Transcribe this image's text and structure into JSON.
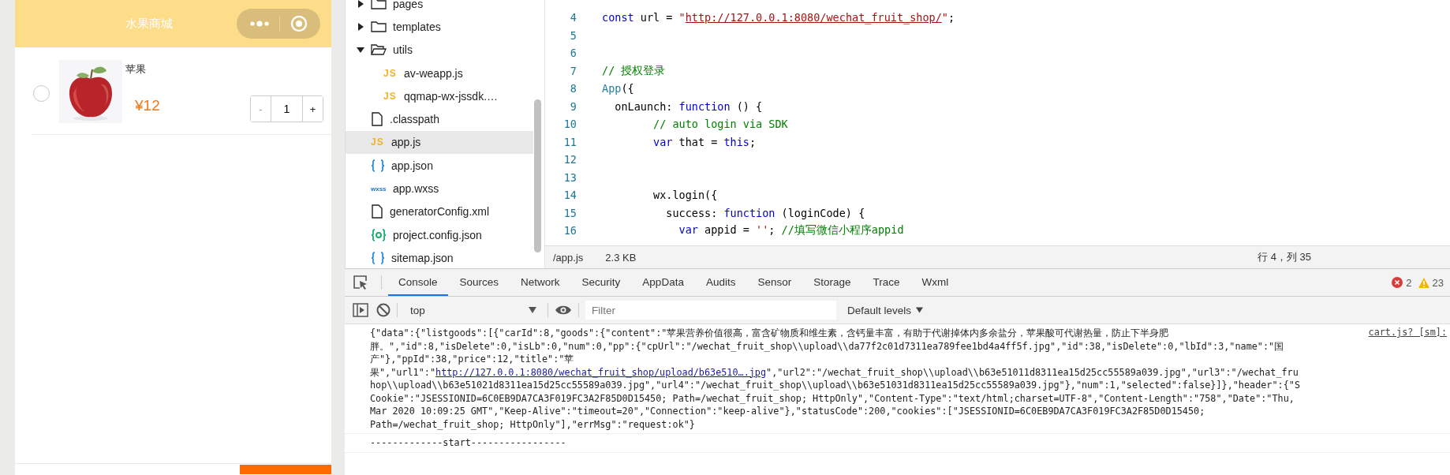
{
  "phone": {
    "title": "水果商城",
    "cart_items": [
      {
        "name": "苹果",
        "price": "¥12",
        "quantity": "1",
        "checked": false,
        "minus": "-",
        "plus": "+"
      }
    ]
  },
  "tree": {
    "items": [
      {
        "name": "pages",
        "kind": "folder",
        "expanded": false,
        "selected": false
      },
      {
        "name": "templates",
        "kind": "folder",
        "expanded": false,
        "selected": false
      },
      {
        "name": "utils",
        "kind": "folder",
        "expanded": true,
        "selected": false,
        "children": [
          {
            "name": "av-weapp.js",
            "kind": "js",
            "icon_text": "JS",
            "selected": false
          },
          {
            "name": "qqmap-wx-jssdk.…",
            "kind": "js",
            "icon_text": "JS",
            "selected": false
          }
        ]
      },
      {
        "name": ".classpath",
        "kind": "file",
        "selected": false
      },
      {
        "name": "app.js",
        "kind": "js",
        "icon_text": "JS",
        "selected": true
      },
      {
        "name": "app.json",
        "kind": "json",
        "selected": false
      },
      {
        "name": "app.wxss",
        "kind": "wxss",
        "icon_text": "wxss",
        "selected": false
      },
      {
        "name": "generatorConfig.xml",
        "kind": "file",
        "selected": false
      },
      {
        "name": "project.config.json",
        "kind": "config",
        "selected": false
      },
      {
        "name": "sitemap.json",
        "kind": "json",
        "selected": false
      }
    ]
  },
  "editor": {
    "lines": [
      {
        "number": "4",
        "parts": [
          {
            "kind": "keyword",
            "text": "const"
          },
          {
            "kind": "plain",
            "text": " url = "
          },
          {
            "kind": "string",
            "text": "\""
          },
          {
            "kind": "link",
            "text": "http://127.0.0.1:8080/wechat_fruit_shop/"
          },
          {
            "kind": "string",
            "text": "\""
          },
          {
            "kind": "plain",
            "text": ";"
          }
        ]
      },
      {
        "number": "5"
      },
      {
        "number": "6"
      },
      {
        "number": "7",
        "parts": [
          {
            "kind": "comment",
            "text": "// 授权登录"
          }
        ]
      },
      {
        "number": "8",
        "parts": [
          {
            "kind": "type",
            "text": "App"
          },
          {
            "kind": "plain",
            "text": "({"
          }
        ]
      },
      {
        "number": "9",
        "parts": [
          {
            "kind": "plain",
            "text": "  onLaunch: "
          },
          {
            "kind": "keyword",
            "text": "function"
          },
          {
            "kind": "plain",
            "text": " () {"
          }
        ]
      },
      {
        "number": "10",
        "parts": [
          {
            "kind": "comment",
            "text": "        // auto login via SDK"
          }
        ]
      },
      {
        "number": "11",
        "parts": [
          {
            "kind": "keyword",
            "text": "        var"
          },
          {
            "kind": "plain",
            "text": " that = "
          },
          {
            "kind": "keyword",
            "text": "this"
          },
          {
            "kind": "plain",
            "text": ";"
          }
        ]
      },
      {
        "number": "12"
      },
      {
        "number": "13"
      },
      {
        "number": "14",
        "parts": [
          {
            "kind": "plain",
            "text": "        wx.login({"
          }
        ]
      },
      {
        "number": "15",
        "parts": [
          {
            "kind": "plain",
            "text": "          success: "
          },
          {
            "kind": "keyword",
            "text": "function"
          },
          {
            "kind": "plain",
            "text": " (loginCode) {"
          }
        ]
      },
      {
        "number": "16",
        "parts": [
          {
            "kind": "keyword",
            "text": "            var"
          },
          {
            "kind": "plain",
            "text": " appid = "
          },
          {
            "kind": "string",
            "text": "''"
          },
          {
            "kind": "plain",
            "text": "; "
          },
          {
            "kind": "comment",
            "text": "//填写微信小程序appid"
          }
        ]
      }
    ],
    "status": {
      "path": "/app.js",
      "size": "2.3 KB",
      "cursor": "行 4，列 35"
    }
  },
  "devtools": {
    "tabs": [
      {
        "label": "Console",
        "selected": true
      },
      {
        "label": "Sources",
        "selected": false
      },
      {
        "label": "Network",
        "selected": false
      },
      {
        "label": "Security",
        "selected": false
      },
      {
        "label": "AppData",
        "selected": false
      },
      {
        "label": "Audits",
        "selected": false
      },
      {
        "label": "Sensor",
        "selected": false
      },
      {
        "label": "Storage",
        "selected": false
      },
      {
        "label": "Trace",
        "selected": false
      },
      {
        "label": "Wxml",
        "selected": false
      }
    ],
    "errors": "2",
    "warnings": "23",
    "context": "top",
    "filter_placeholder": "Filter",
    "levels": "Default levels"
  },
  "console": {
    "messages": [
      {
        "source": "cart.js? [sm]:",
        "lines": [
          [
            {
              "kind": "text",
              "text": "{\"data\":{\"listgoods\":[{\"carId\":8,\"goods\":{\"content\":\"苹果营养价值很高，富含矿物质和维生素，含钙量丰富，有助于代谢掉体内多余盐分，苹果酸可代谢热量，防止下半身肥"
            }
          ],
          [
            {
              "kind": "text",
              "text": "胖。\",\"id\":8,\"isDelete\":0,\"isLb\":0,\"num\":0,\"pp\":{\"cpUrl\":\"/wechat_fruit_shop\\\\upload\\\\da77f2c01d7311ea789fee1bd4a4ff5f.jpg\",\"id\":38,\"isDelete\":0,\"lbId\":3,\"name\":\"国"
            }
          ],
          [
            {
              "kind": "text",
              "text": "产\"},\"ppId\":38,\"price\":12,\"title\":\"苹"
            }
          ],
          [
            {
              "kind": "text",
              "text": "果\",\"url1\":\""
            },
            {
              "kind": "link",
              "text": "http://127.0.0.1:8080/wechat_fruit_shop/upload/b63e510….jpg"
            },
            {
              "kind": "text",
              "text": "\",\"url2\":\"/wechat_fruit_shop\\\\upload\\\\b63e51011d8311ea15d25cc55589a039.jpg\",\"url3\":\"/wechat_fru"
            }
          ],
          [
            {
              "kind": "text",
              "text": "hop\\\\upload\\\\b63e51021d8311ea15d25cc55589a039.jpg\",\"url4\":\"/wechat_fruit_shop\\\\upload\\\\b63e51031d8311ea15d25cc55589a039.jpg\"},\"num\":1,\"selected\":false}]},\"header\":{\"S"
            }
          ],
          [
            {
              "kind": "text",
              "text": "Cookie\":\"JSESSIONID=6C0EB9DA7CA3F019FC3A2F85D0D15450; Path=/wechat_fruit_shop; HttpOnly\",\"Content-Type\":\"text/html;charset=UTF-8\",\"Content-Length\":\"758\",\"Date\":\"Thu,"
            }
          ],
          [
            {
              "kind": "text",
              "text": "Mar 2020 10:09:25 GMT\",\"Keep-Alive\":\"timeout=20\",\"Connection\":\"keep-alive\"},\"statusCode\":200,\"cookies\":[\"JSESSIONID=6C0EB9DA7CA3F019FC3A2F85D0D15450;"
            }
          ],
          [
            {
              "kind": "text",
              "text": "Path=/wechat_fruit_shop; HttpOnly\"],\"errMsg\":\"request:ok\"}"
            }
          ]
        ]
      },
      {
        "lines": [
          [
            {
              "kind": "text",
              "text": "-------------start-----------------"
            }
          ]
        ]
      }
    ]
  }
}
